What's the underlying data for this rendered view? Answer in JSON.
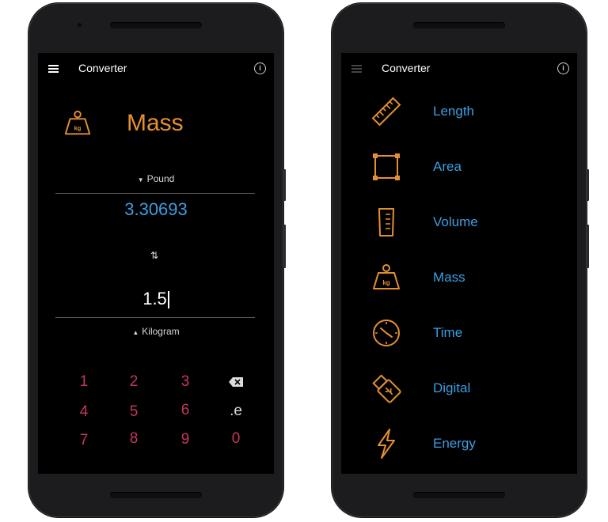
{
  "left_phone": {
    "app_title": "Converter",
    "converter": {
      "category": "Mass",
      "to_unit": "Pound",
      "result": "3.30693",
      "input_value": "1.5",
      "from_unit": "Kilogram"
    },
    "keypad": {
      "keys": [
        "1",
        "2",
        "3",
        "4",
        "5",
        "6",
        ".e",
        "7",
        "8",
        "9",
        "0"
      ]
    }
  },
  "right_phone": {
    "app_title": "Converter",
    "categories": [
      {
        "label": "Length",
        "icon": "ruler-icon"
      },
      {
        "label": "Area",
        "icon": "area-icon"
      },
      {
        "label": "Volume",
        "icon": "beaker-icon"
      },
      {
        "label": "Mass",
        "icon": "weight-icon"
      },
      {
        "label": "Time",
        "icon": "clock-icon"
      },
      {
        "label": "Digital",
        "icon": "usb-icon"
      },
      {
        "label": "Energy",
        "icon": "lightning-icon"
      }
    ]
  },
  "colors": {
    "accent_orange": "#e5902f",
    "accent_blue": "#3b9ee2",
    "key_red": "#c5385b",
    "background": "#000000"
  }
}
